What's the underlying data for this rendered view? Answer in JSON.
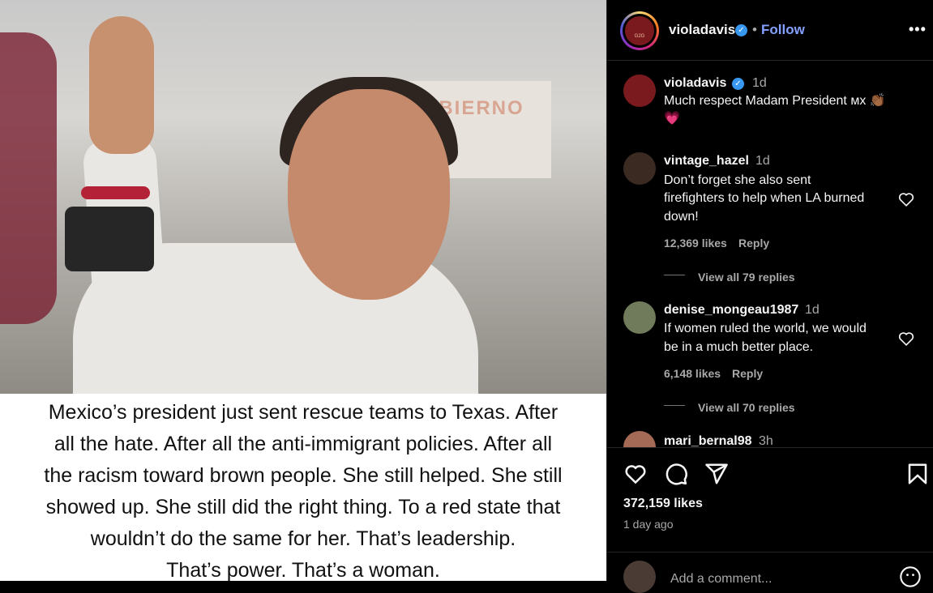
{
  "post": {
    "image_banner_text": "GOBIERNO",
    "caption_lines": [
      "Mexico’s president just sent rescue teams to Texas. After",
      "all the hate. After all the anti-immigrant policies. After all",
      "the racism toward brown people. She still helped. She still",
      "showed up. She still did the right thing. To a red state that",
      "wouldn’t do the same for her. That’s leadership.",
      "That’s power. That’s a woman."
    ]
  },
  "header": {
    "username": "violadavis",
    "separator": "•",
    "follow_label": "Follow",
    "more_label": "•••",
    "avatar_text": "G2G"
  },
  "comments": [
    {
      "username": "violadavis",
      "time": "1d",
      "verified": true,
      "lines": [
        "Much respect Madam President мх 👏🏾",
        "💗"
      ]
    },
    {
      "username": "vintage_hazel",
      "time": "1d",
      "lines": [
        "Don’t forget she also sent",
        "firefighters to help when LA burned",
        "down!"
      ],
      "likes": "12,369 likes",
      "reply_label": "Reply",
      "view_replies": "View all 79 replies"
    },
    {
      "username": "denise_mongeau1987",
      "time": "1d",
      "lines": [
        "If women ruled the world, we would",
        "be in a much better place."
      ],
      "likes": "6,148 likes",
      "reply_label": "Reply",
      "view_replies": "View all 70 replies"
    },
    {
      "username": "mari_bernal98",
      "time": "3h",
      "lines": []
    }
  ],
  "footer": {
    "likes": "372,159 likes",
    "date": "1 day ago",
    "add_comment_placeholder": "Add a comment..."
  },
  "colors": {
    "follow": "#85a1ff",
    "verified": "#3897f0",
    "muted": "#a8a8a8"
  }
}
